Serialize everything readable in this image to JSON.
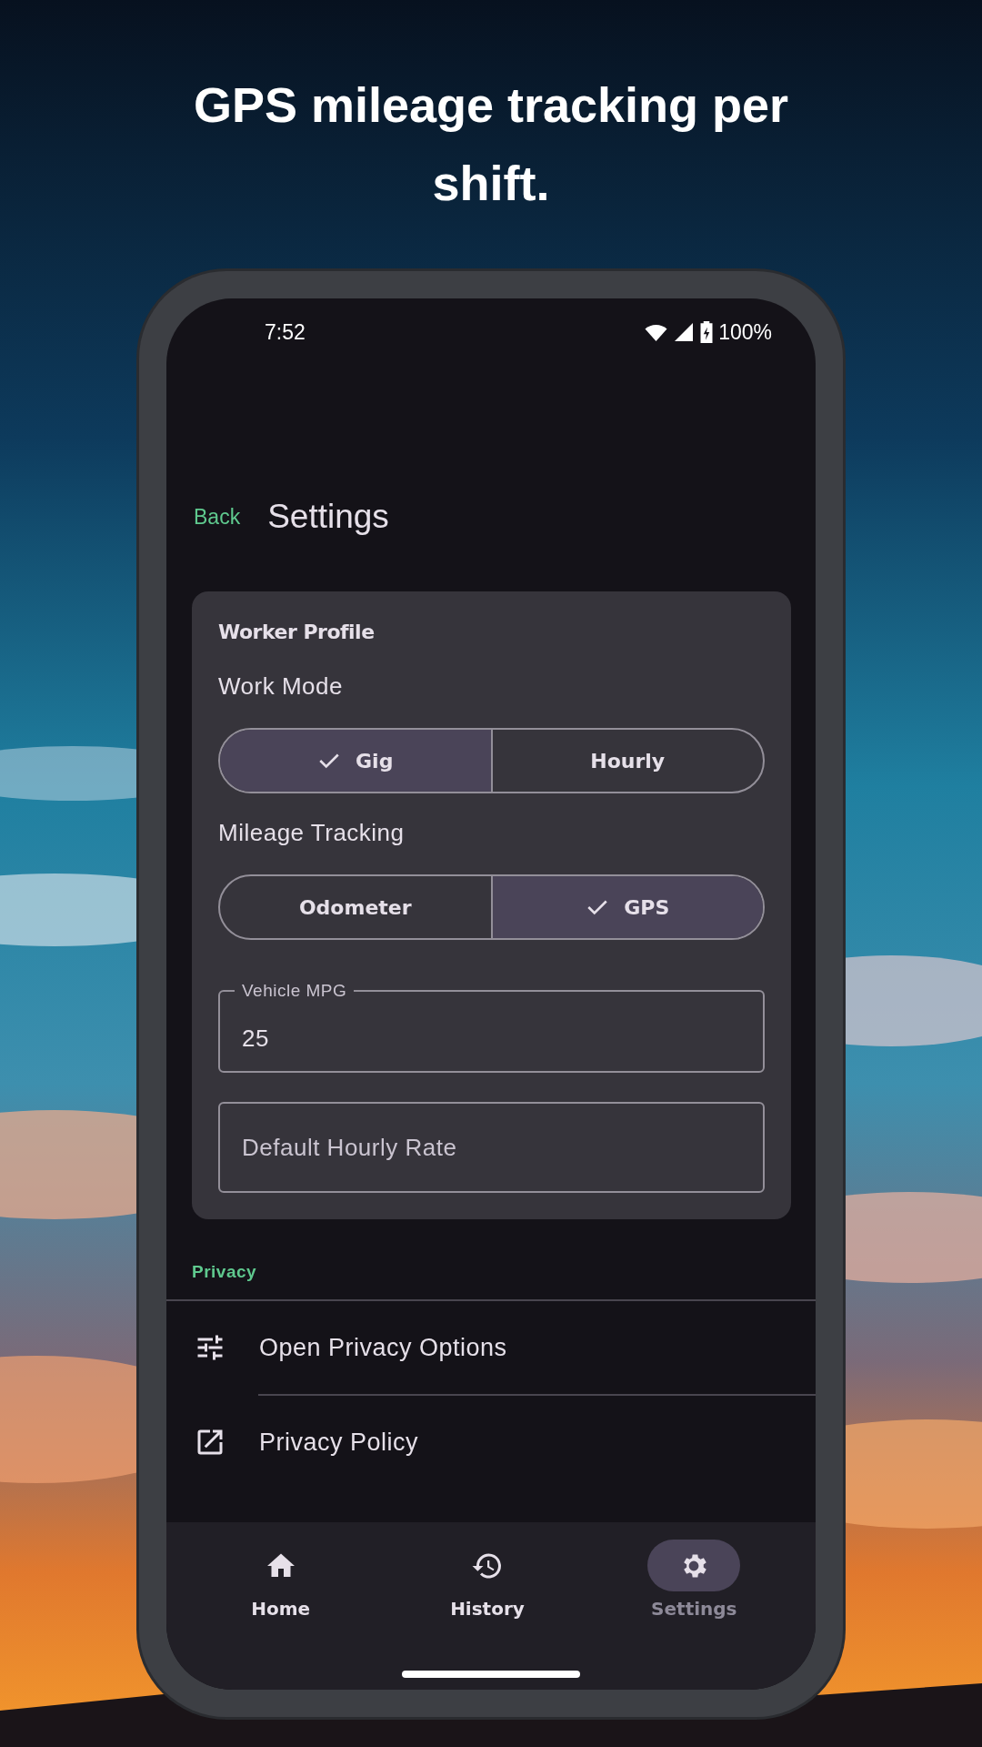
{
  "headline": "GPS mileage tracking per shift.",
  "status_bar": {
    "time": "7:52",
    "battery": "100%"
  },
  "header": {
    "back": "Back",
    "title": "Settings"
  },
  "card": {
    "title": "Worker Profile",
    "groups": [
      {
        "label": "Work Mode",
        "options": [
          {
            "label": "Gig",
            "selected": true
          },
          {
            "label": "Hourly",
            "selected": false
          }
        ]
      },
      {
        "label": "Mileage Tracking",
        "options": [
          {
            "label": "Odometer",
            "selected": false
          },
          {
            "label": "GPS",
            "selected": true
          }
        ]
      }
    ],
    "fields": [
      {
        "label": "Vehicle MPG",
        "value": "25"
      },
      {
        "placeholder": "Default Hourly Rate"
      }
    ]
  },
  "privacy": {
    "heading": "Privacy",
    "items": [
      {
        "kind": "tune",
        "label": "Open Privacy Options"
      },
      {
        "kind": "external",
        "label": "Privacy Policy"
      }
    ]
  },
  "nav": [
    {
      "kind": "home",
      "label": "Home",
      "selected": false
    },
    {
      "kind": "history",
      "label": "History",
      "selected": false
    },
    {
      "kind": "settings",
      "label": "Settings",
      "selected": true
    }
  ]
}
